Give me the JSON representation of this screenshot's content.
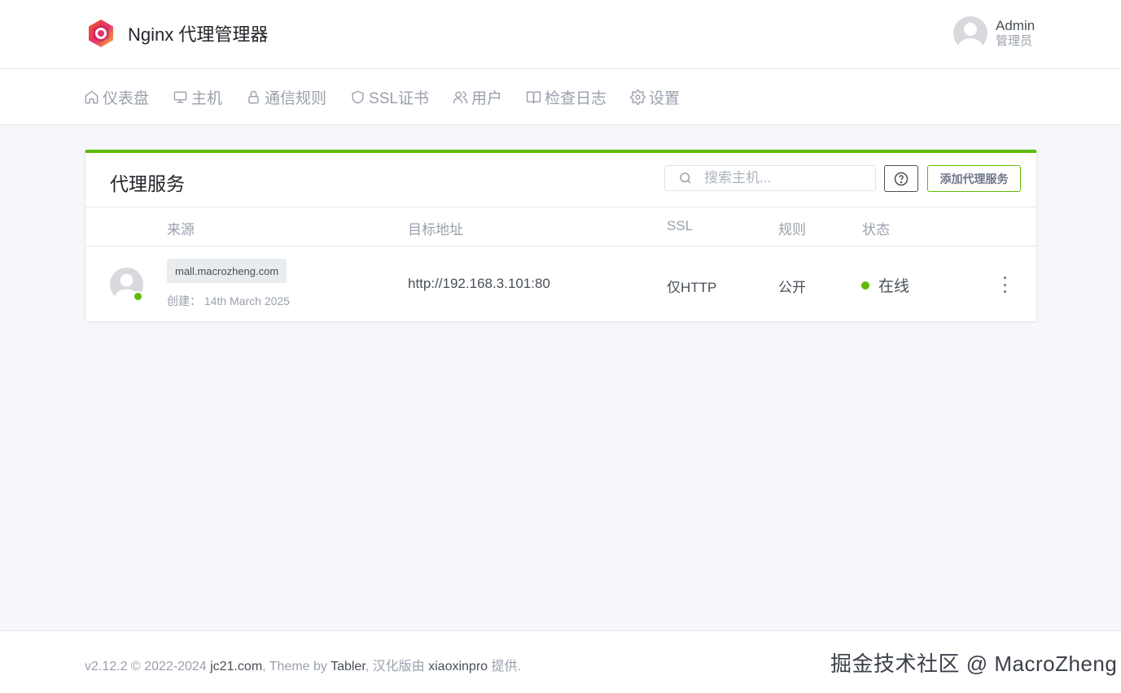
{
  "header": {
    "app_title": "Nginx 代理管理器",
    "user_name": "Admin",
    "user_role": "管理员"
  },
  "nav": {
    "items": [
      {
        "label": "仪表盘",
        "icon": "home-icon"
      },
      {
        "label": "主机",
        "icon": "monitor-icon"
      },
      {
        "label": "通信规则",
        "icon": "lock-icon"
      },
      {
        "label": "SSL证书",
        "icon": "shield-icon"
      },
      {
        "label": "用户",
        "icon": "users-icon"
      },
      {
        "label": "检查日志",
        "icon": "book-icon"
      },
      {
        "label": "设置",
        "icon": "gear-icon"
      }
    ]
  },
  "card": {
    "title": "代理服务",
    "search_placeholder": "搜索主机...",
    "add_button": "添加代理服务",
    "columns": {
      "source": "来源",
      "target": "目标地址",
      "ssl": "SSL",
      "rules": "规则",
      "status": "状态"
    },
    "rows": [
      {
        "domain": "mall.macrozheng.com",
        "created": "创建： 14th March 2025",
        "target": "http://192.168.3.101:80",
        "ssl": "仅HTTP",
        "rules": "公开",
        "status": "在线"
      }
    ]
  },
  "footer": {
    "version": "v2.12.2 © 2022-2024 ",
    "link_jc21": "jc21.com",
    "theme_by": ", Theme by ",
    "link_tabler": "Tabler",
    "hanhua": ", 汉化版由 ",
    "link_xiaoxin": "xiaoxinpro",
    "provided": " 提供.",
    "watermark": "掘金技术社区 @ MacroZheng"
  },
  "colors": {
    "accent": "#5eba00",
    "text": "#495057",
    "muted": "#9aa0ac",
    "background": "#f5f7fb"
  }
}
